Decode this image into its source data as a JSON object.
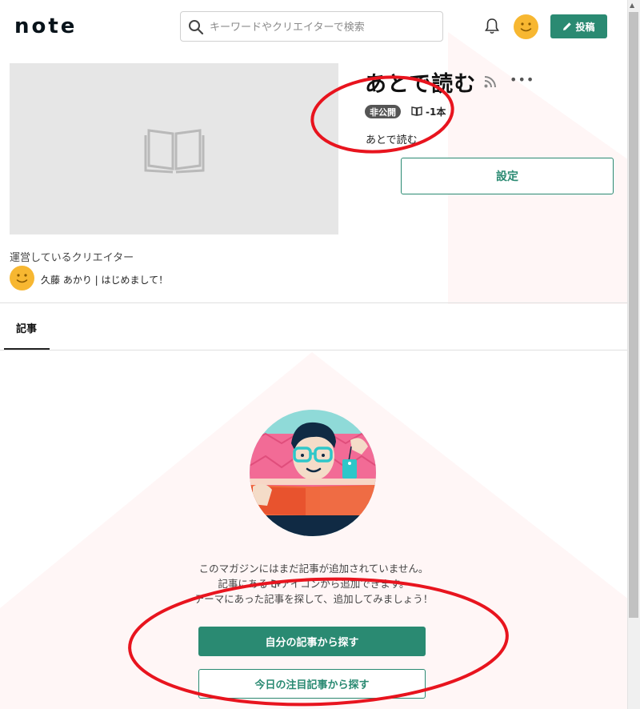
{
  "header": {
    "logo": "note",
    "search_placeholder": "キーワードやクリエイターで検索",
    "post_label": "投稿"
  },
  "magazine": {
    "title": "あとで読む",
    "visibility_badge": "非公開",
    "article_count": "-1本",
    "description": "あとで読む",
    "settings_label": "設定",
    "creator_label": "運営しているクリエイター",
    "creator_name": "久藤 あかり | はじめまして！"
  },
  "tabs": [
    {
      "label": "記事",
      "active": true
    }
  ],
  "empty_state": {
    "line1": "このマガジンにはまだ記事が追加されていません。",
    "line2_pre": "記事にある",
    "line2_post": "アイコンから追加できます。",
    "line3": "テーマにあった記事を探して、追加してみましょう！",
    "own_button": "自分の記事から探す",
    "today_button": "今日の注目記事から探す"
  },
  "icons": {
    "search": "search-icon",
    "notification": "bell-icon",
    "post": "pencil-icon",
    "rss": "rss-icon",
    "more": "more-icon",
    "book": "book-icon",
    "cover_placeholder": "open-book-icon",
    "add_to_magazine": "add-to-magazine-icon"
  },
  "colors": {
    "brand_green": "#2a8a72",
    "avatar_yellow": "#f7b731",
    "badge_gray": "#555555",
    "annotation_red": "#e8141e"
  }
}
